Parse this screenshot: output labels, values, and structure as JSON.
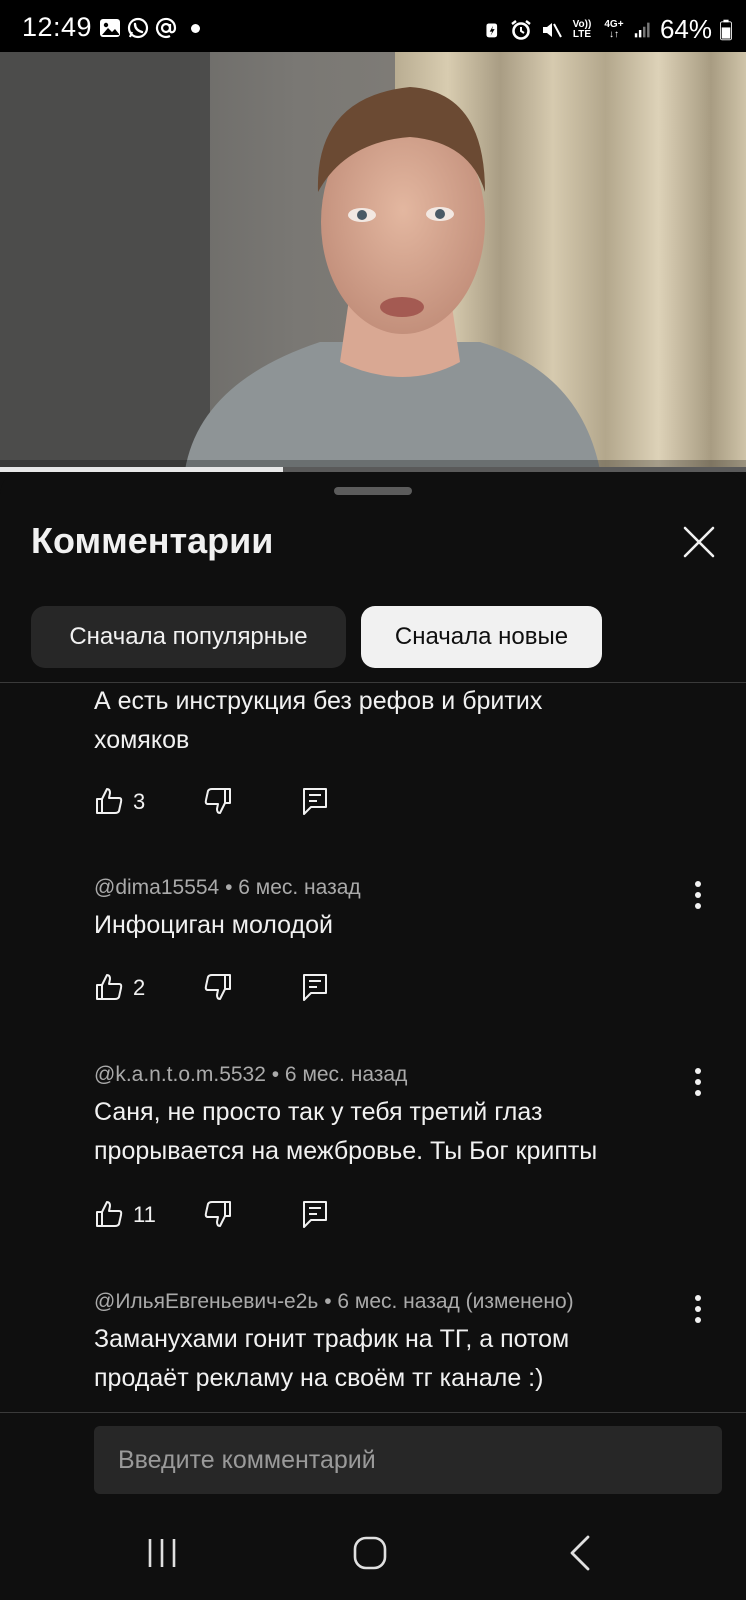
{
  "status": {
    "time": "12:49",
    "battery": "64%",
    "volte_top": "Vo))",
    "volte_bottom": "LTE",
    "net_top": "4G+"
  },
  "video": {
    "progress_fraction": 0.38
  },
  "sheet": {
    "title": "Комментарии"
  },
  "filters": {
    "popular_label": "Сначала популярные",
    "newest_label": "Сначала новые",
    "selected": "newest"
  },
  "comments": [
    {
      "meta": "",
      "text_line1": "А есть инструкция без рефов и бритих",
      "text_line2": "хомяков",
      "likes": "3"
    },
    {
      "meta": "@dima15554 • 6 мес. назад",
      "text_line1": "Инфоциган молодой",
      "likes": "2"
    },
    {
      "meta": "@k.a.n.t.o.m.5532 • 6 мес. назад",
      "text_line1": "Саня, не просто так у тебя третий глаз",
      "text_line2": "прорывается на межбровье. Ты Бог крипты",
      "likes": "11"
    },
    {
      "meta": "@ИльяЕвгеньевич-е2ь • 6 мес. назад (изменено)",
      "text_line1": "Заманухами гонит трафик на ТГ, а потом",
      "text_line2": "продаёт рекламу на своём тг канале :)"
    }
  ],
  "input": {
    "placeholder": "Введите комментарий"
  },
  "icons": {
    "like": "thumb-up-icon",
    "dislike": "thumb-down-icon",
    "reply": "reply-comment-icon",
    "more": "more-vertical-icon",
    "close": "close-icon"
  }
}
